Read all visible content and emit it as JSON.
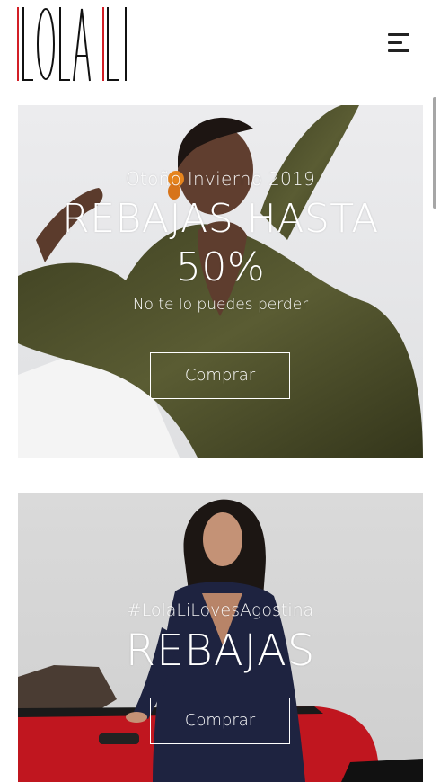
{
  "header": {
    "logo_text": "LOLA LI",
    "menu_icon": "hamburger-menu-icon"
  },
  "banners": [
    {
      "kicker": "Otoño Invierno 2019",
      "headline_line1": "REBAJAS HASTA",
      "headline_line2": "50%",
      "subtitle": "No te lo puedes perder",
      "cta_label": "Comprar"
    },
    {
      "kicker": "#LolaLiLovesAgostina",
      "headline": "REBAJAS",
      "cta_label": "Comprar"
    }
  ],
  "colors": {
    "logo_red": "#d21f26",
    "logo_black": "#111111",
    "dress_green": "#4b4d2a",
    "earring_orange": "#e7851d",
    "car_red": "#c0161f",
    "dress_navy": "#1e2340"
  }
}
